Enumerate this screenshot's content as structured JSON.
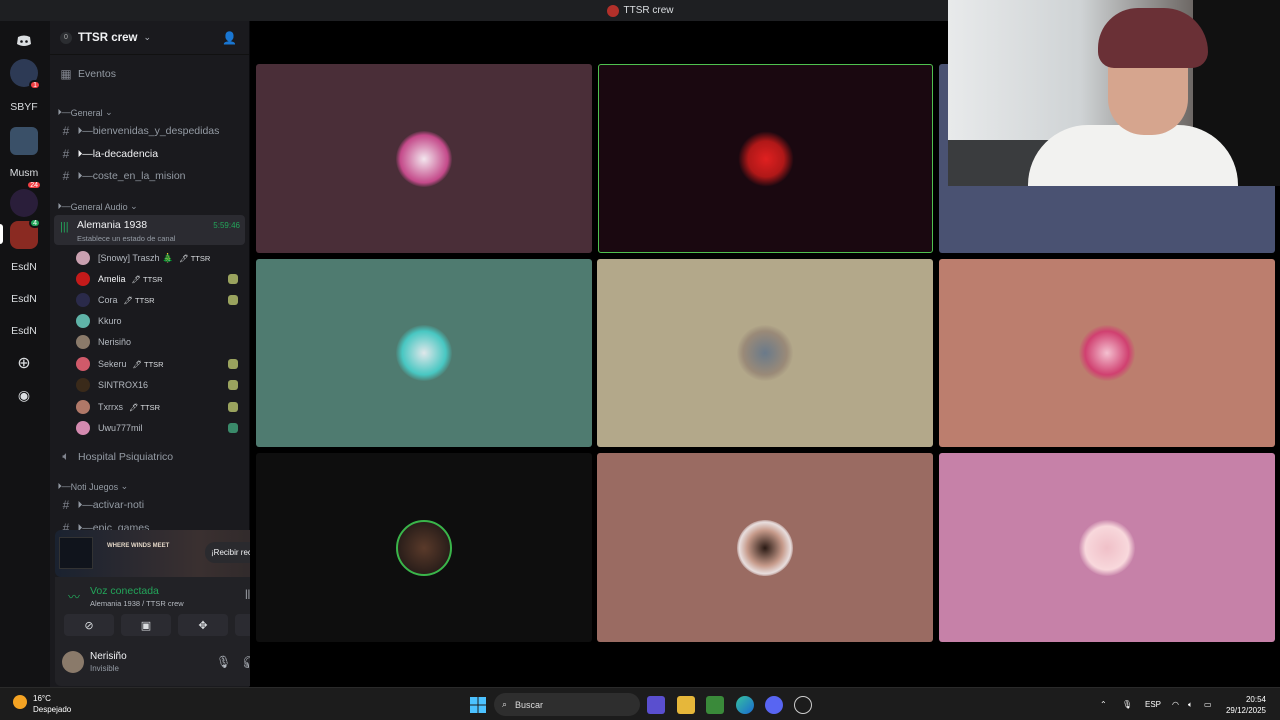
{
  "window": {
    "title": "TTSR crew"
  },
  "server_rail": {
    "items": [
      {
        "name": "discord-home-icon"
      },
      {
        "badge": "1"
      },
      {
        "label": "SBYF"
      },
      {
        "name": "server"
      },
      {
        "label": "Musm",
        "badge": "24"
      },
      {
        "name": "server"
      },
      {
        "name": "server",
        "badge": "4"
      },
      {
        "label": "EsdN"
      },
      {
        "label": "EsdN"
      },
      {
        "label": "EsdN"
      },
      {
        "name": "add-server-icon"
      },
      {
        "name": "discover-icon"
      }
    ]
  },
  "guild": {
    "level": "0",
    "name": "TTSR crew",
    "events_label": "Eventos"
  },
  "channels": {
    "cat_general": "General",
    "ch1": "🞂—bienvenidas_y_despedidas",
    "ch2": "🞂—la-decadencia",
    "ch3": "🞂—coste_en_la_mision",
    "cat_audio": "General Audio",
    "voice": {
      "name": "Alemania 1938",
      "timer": "5:59:46",
      "status": "Establece un estado de canal"
    },
    "hospital": "Hospital Psiquiatrico",
    "cat_noti": "Noti Juegos",
    "ch4": "🞂—activar-noti",
    "ch5": "🞂—epic_games"
  },
  "voice_users": [
    {
      "name": "[Snowy] Traszh 🎄",
      "tag": "TTSR"
    },
    {
      "name": "Amelia",
      "tag": "TTSR"
    },
    {
      "name": "Cora",
      "tag": "TTSR"
    },
    {
      "name": "Kkuro",
      "tag": ""
    },
    {
      "name": "Nerisiño",
      "tag": ""
    },
    {
      "name": "Sekeru",
      "tag": "TTSR"
    },
    {
      "name": "SINTROX16",
      "tag": ""
    },
    {
      "name": "Txrrxs",
      "tag": "TTSR"
    },
    {
      "name": "Uwu777mil",
      "tag": ""
    }
  ],
  "promo": {
    "game": "WHERE WINDS MEET",
    "cta": "¡Recibir recompensa!"
  },
  "voice_panel": {
    "status": "Voz conectada",
    "location": "Alemania 1938 / TTSR crew"
  },
  "me": {
    "name": "Nerisiño",
    "status": "Invisible"
  },
  "stage": {
    "tiles": [
      {
        "color": "#4a2e38"
      },
      {
        "color": "#1a0810"
      },
      {
        "color": "#4a5272"
      },
      {
        "color": "#4f7b70"
      },
      {
        "color": "#b3a88a"
      },
      {
        "color": "#bc7e6e"
      },
      {
        "color": "#0e0e0e"
      },
      {
        "color": "#9a6b62"
      },
      {
        "color": "#c681a8"
      }
    ]
  },
  "taskbar": {
    "temp": "16°C",
    "condition": "Despejado",
    "search_placeholder": "Buscar",
    "lang": "ESP",
    "time": "20:54",
    "date": "29/12/2025"
  }
}
